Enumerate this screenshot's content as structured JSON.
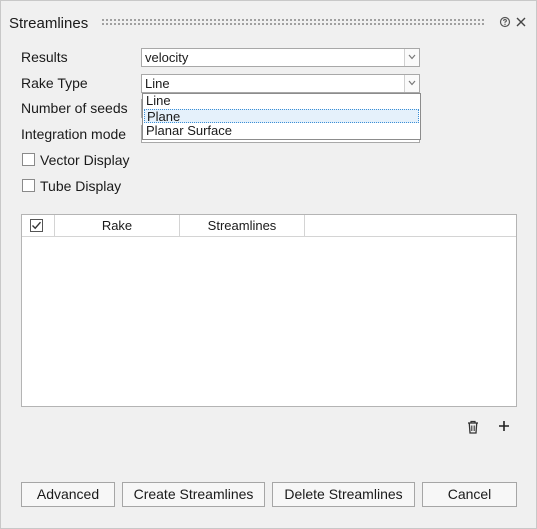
{
  "window": {
    "title": "Streamlines"
  },
  "form": {
    "results": {
      "label": "Results",
      "value": "velocity"
    },
    "rake_type": {
      "label": "Rake Type",
      "value": "Line",
      "options": [
        "Line",
        "Plane",
        "Planar Surface"
      ],
      "highlighted": "Plane"
    },
    "number_of_seeds": {
      "label": "Number of seeds"
    },
    "integration_mode": {
      "label": "Integration mode"
    },
    "vector_display": {
      "label": "Vector Display",
      "checked": false
    },
    "tube_display": {
      "label": "Tube Display",
      "checked": false
    }
  },
  "table": {
    "columns": [
      "Rake",
      "Streamlines"
    ],
    "rows": []
  },
  "buttons": {
    "advanced": "Advanced",
    "create": "Create Streamlines",
    "delete": "Delete Streamlines",
    "cancel": "Cancel"
  }
}
